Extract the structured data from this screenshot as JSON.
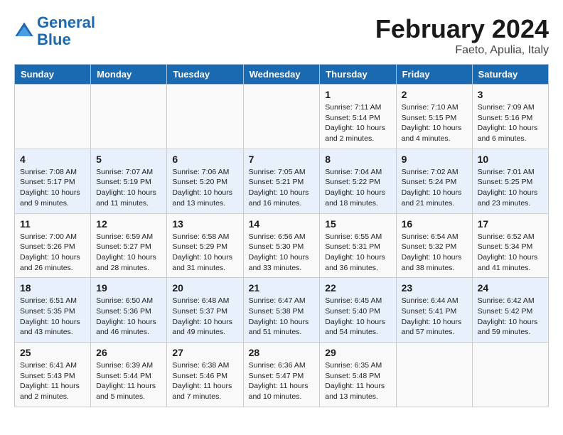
{
  "header": {
    "logo_line1": "General",
    "logo_line2": "Blue",
    "title": "February 2024",
    "subtitle": "Faeto, Apulia, Italy"
  },
  "days_of_week": [
    "Sunday",
    "Monday",
    "Tuesday",
    "Wednesday",
    "Thursday",
    "Friday",
    "Saturday"
  ],
  "weeks": [
    [
      {
        "day": "",
        "info": ""
      },
      {
        "day": "",
        "info": ""
      },
      {
        "day": "",
        "info": ""
      },
      {
        "day": "",
        "info": ""
      },
      {
        "day": "1",
        "info": "Sunrise: 7:11 AM\nSunset: 5:14 PM\nDaylight: 10 hours\nand 2 minutes."
      },
      {
        "day": "2",
        "info": "Sunrise: 7:10 AM\nSunset: 5:15 PM\nDaylight: 10 hours\nand 4 minutes."
      },
      {
        "day": "3",
        "info": "Sunrise: 7:09 AM\nSunset: 5:16 PM\nDaylight: 10 hours\nand 6 minutes."
      }
    ],
    [
      {
        "day": "4",
        "info": "Sunrise: 7:08 AM\nSunset: 5:17 PM\nDaylight: 10 hours\nand 9 minutes."
      },
      {
        "day": "5",
        "info": "Sunrise: 7:07 AM\nSunset: 5:19 PM\nDaylight: 10 hours\nand 11 minutes."
      },
      {
        "day": "6",
        "info": "Sunrise: 7:06 AM\nSunset: 5:20 PM\nDaylight: 10 hours\nand 13 minutes."
      },
      {
        "day": "7",
        "info": "Sunrise: 7:05 AM\nSunset: 5:21 PM\nDaylight: 10 hours\nand 16 minutes."
      },
      {
        "day": "8",
        "info": "Sunrise: 7:04 AM\nSunset: 5:22 PM\nDaylight: 10 hours\nand 18 minutes."
      },
      {
        "day": "9",
        "info": "Sunrise: 7:02 AM\nSunset: 5:24 PM\nDaylight: 10 hours\nand 21 minutes."
      },
      {
        "day": "10",
        "info": "Sunrise: 7:01 AM\nSunset: 5:25 PM\nDaylight: 10 hours\nand 23 minutes."
      }
    ],
    [
      {
        "day": "11",
        "info": "Sunrise: 7:00 AM\nSunset: 5:26 PM\nDaylight: 10 hours\nand 26 minutes."
      },
      {
        "day": "12",
        "info": "Sunrise: 6:59 AM\nSunset: 5:27 PM\nDaylight: 10 hours\nand 28 minutes."
      },
      {
        "day": "13",
        "info": "Sunrise: 6:58 AM\nSunset: 5:29 PM\nDaylight: 10 hours\nand 31 minutes."
      },
      {
        "day": "14",
        "info": "Sunrise: 6:56 AM\nSunset: 5:30 PM\nDaylight: 10 hours\nand 33 minutes."
      },
      {
        "day": "15",
        "info": "Sunrise: 6:55 AM\nSunset: 5:31 PM\nDaylight: 10 hours\nand 36 minutes."
      },
      {
        "day": "16",
        "info": "Sunrise: 6:54 AM\nSunset: 5:32 PM\nDaylight: 10 hours\nand 38 minutes."
      },
      {
        "day": "17",
        "info": "Sunrise: 6:52 AM\nSunset: 5:34 PM\nDaylight: 10 hours\nand 41 minutes."
      }
    ],
    [
      {
        "day": "18",
        "info": "Sunrise: 6:51 AM\nSunset: 5:35 PM\nDaylight: 10 hours\nand 43 minutes."
      },
      {
        "day": "19",
        "info": "Sunrise: 6:50 AM\nSunset: 5:36 PM\nDaylight: 10 hours\nand 46 minutes."
      },
      {
        "day": "20",
        "info": "Sunrise: 6:48 AM\nSunset: 5:37 PM\nDaylight: 10 hours\nand 49 minutes."
      },
      {
        "day": "21",
        "info": "Sunrise: 6:47 AM\nSunset: 5:38 PM\nDaylight: 10 hours\nand 51 minutes."
      },
      {
        "day": "22",
        "info": "Sunrise: 6:45 AM\nSunset: 5:40 PM\nDaylight: 10 hours\nand 54 minutes."
      },
      {
        "day": "23",
        "info": "Sunrise: 6:44 AM\nSunset: 5:41 PM\nDaylight: 10 hours\nand 57 minutes."
      },
      {
        "day": "24",
        "info": "Sunrise: 6:42 AM\nSunset: 5:42 PM\nDaylight: 10 hours\nand 59 minutes."
      }
    ],
    [
      {
        "day": "25",
        "info": "Sunrise: 6:41 AM\nSunset: 5:43 PM\nDaylight: 11 hours\nand 2 minutes."
      },
      {
        "day": "26",
        "info": "Sunrise: 6:39 AM\nSunset: 5:44 PM\nDaylight: 11 hours\nand 5 minutes."
      },
      {
        "day": "27",
        "info": "Sunrise: 6:38 AM\nSunset: 5:46 PM\nDaylight: 11 hours\nand 7 minutes."
      },
      {
        "day": "28",
        "info": "Sunrise: 6:36 AM\nSunset: 5:47 PM\nDaylight: 11 hours\nand 10 minutes."
      },
      {
        "day": "29",
        "info": "Sunrise: 6:35 AM\nSunset: 5:48 PM\nDaylight: 11 hours\nand 13 minutes."
      },
      {
        "day": "",
        "info": ""
      },
      {
        "day": "",
        "info": ""
      }
    ]
  ]
}
